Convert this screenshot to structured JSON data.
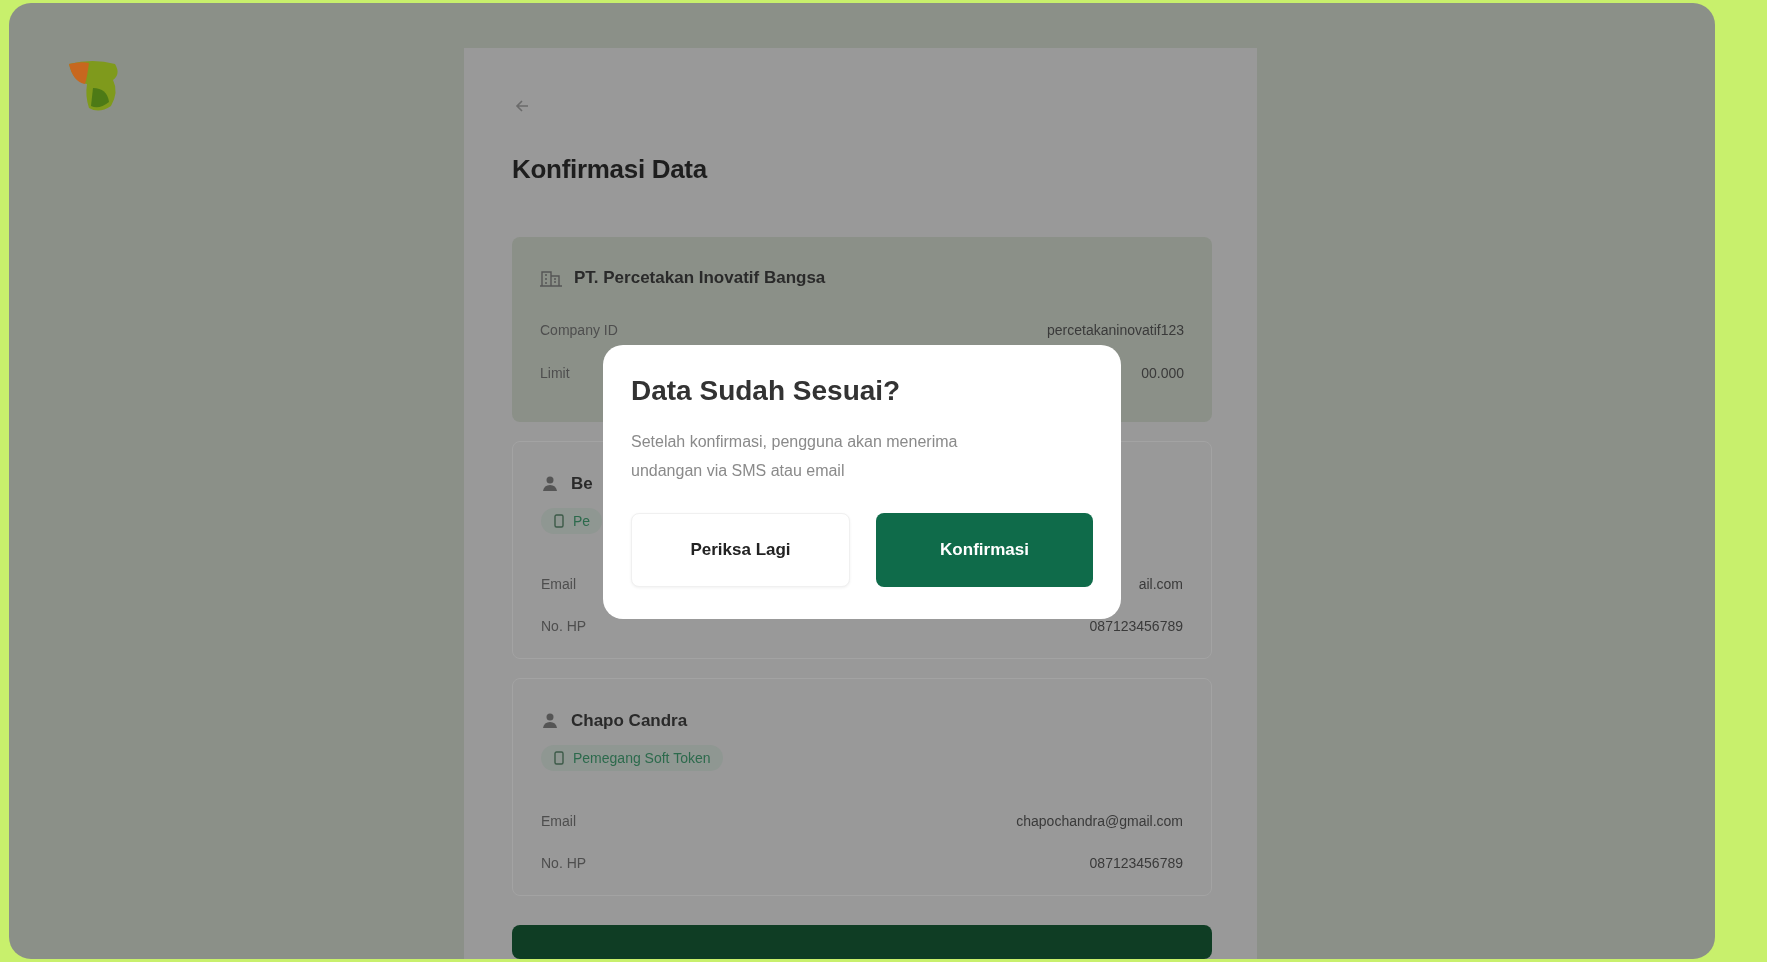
{
  "page": {
    "title": "Konfirmasi Data"
  },
  "company": {
    "name": "PT. Percetakan Inovatif Bangsa",
    "rows": [
      {
        "label": "Company ID",
        "value": "percetakaninovatif123"
      },
      {
        "label": "Limit",
        "value": "00.000"
      }
    ]
  },
  "users": [
    {
      "name": "Be",
      "role": "Pe",
      "rows": [
        {
          "label": "Email",
          "value": "ail.com"
        },
        {
          "label": "No. HP",
          "value": "087123456789"
        }
      ]
    },
    {
      "name": "Chapo Candra",
      "role": "Pemegang Soft Token",
      "rows": [
        {
          "label": "Email",
          "value": "chapochandra@gmail.com"
        },
        {
          "label": "No. HP",
          "value": "087123456789"
        }
      ]
    }
  ],
  "dialog": {
    "title": "Data Sudah Sesuai?",
    "message": "Setelah konfirmasi, pengguna akan menerima undangan via SMS atau email",
    "buttons": [
      {
        "label": "Periksa Lagi",
        "kind": "secondary"
      },
      {
        "label": "Konfirmasi",
        "kind": "primary"
      }
    ]
  }
}
